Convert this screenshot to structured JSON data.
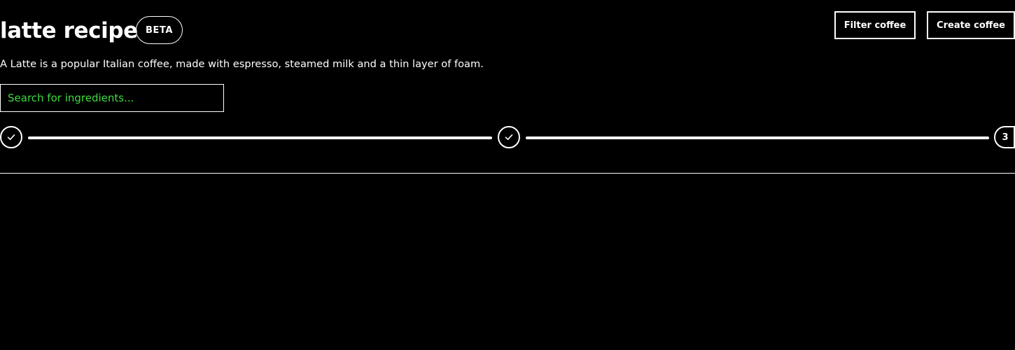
{
  "header": {
    "title": "latte recipe",
    "badge": "BETA",
    "filter_button": "Filter coffee",
    "create_button": "Create coffee"
  },
  "description": "A Latte is a popular Italian coffee, made with espresso, steamed milk and a thin layer of foam.",
  "search": {
    "placeholder": "Search for ingredients...",
    "value": ""
  },
  "stepper": {
    "steps": [
      {
        "state": "complete",
        "icon": "check-icon"
      },
      {
        "state": "complete",
        "icon": "check-icon"
      },
      {
        "state": "current",
        "label": "3"
      }
    ]
  },
  "colors": {
    "background": "#000000",
    "foreground": "#ffffff",
    "placeholder": "#3ddc3d"
  }
}
